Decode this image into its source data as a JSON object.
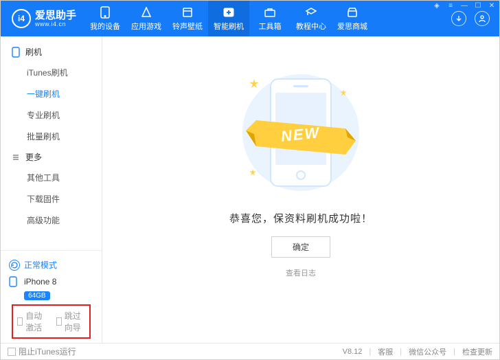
{
  "app": {
    "name": "爱思助手",
    "sub": "www.i4.cn"
  },
  "tabs": [
    {
      "id": "device",
      "label": "我的设备"
    },
    {
      "id": "apps",
      "label": "应用游戏"
    },
    {
      "id": "rings",
      "label": "铃声壁纸"
    },
    {
      "id": "flash",
      "label": "智能刷机",
      "active": true
    },
    {
      "id": "tools",
      "label": "工具箱"
    },
    {
      "id": "course",
      "label": "教程中心"
    },
    {
      "id": "shop",
      "label": "爱思商城"
    }
  ],
  "sidebar": {
    "groups": [
      {
        "id": "flash",
        "label": "刷机",
        "items": [
          {
            "id": "itunes",
            "label": "iTunes刷机"
          },
          {
            "id": "onekey",
            "label": "一键刷机",
            "active": true
          },
          {
            "id": "pro",
            "label": "专业刷机"
          },
          {
            "id": "batch",
            "label": "批量刷机"
          }
        ]
      },
      {
        "id": "more",
        "label": "更多",
        "items": [
          {
            "id": "other",
            "label": "其他工具"
          },
          {
            "id": "firmware",
            "label": "下载固件"
          },
          {
            "id": "advance",
            "label": "高级功能"
          }
        ]
      }
    ]
  },
  "device": {
    "mode": "正常模式",
    "name": "iPhone 8",
    "storage": "64GB"
  },
  "options": {
    "autoActivate": "自动激活",
    "skipGuide": "跳过向导"
  },
  "main": {
    "badge": "NEW",
    "success": "恭喜您，保资料刷机成功啦！",
    "confirm": "确定",
    "viewlog": "查看日志"
  },
  "footer": {
    "blockItunes": "阻止iTunes运行",
    "version": "V8.12",
    "support": "客服",
    "wechat": "微信公众号",
    "update": "检查更新"
  }
}
